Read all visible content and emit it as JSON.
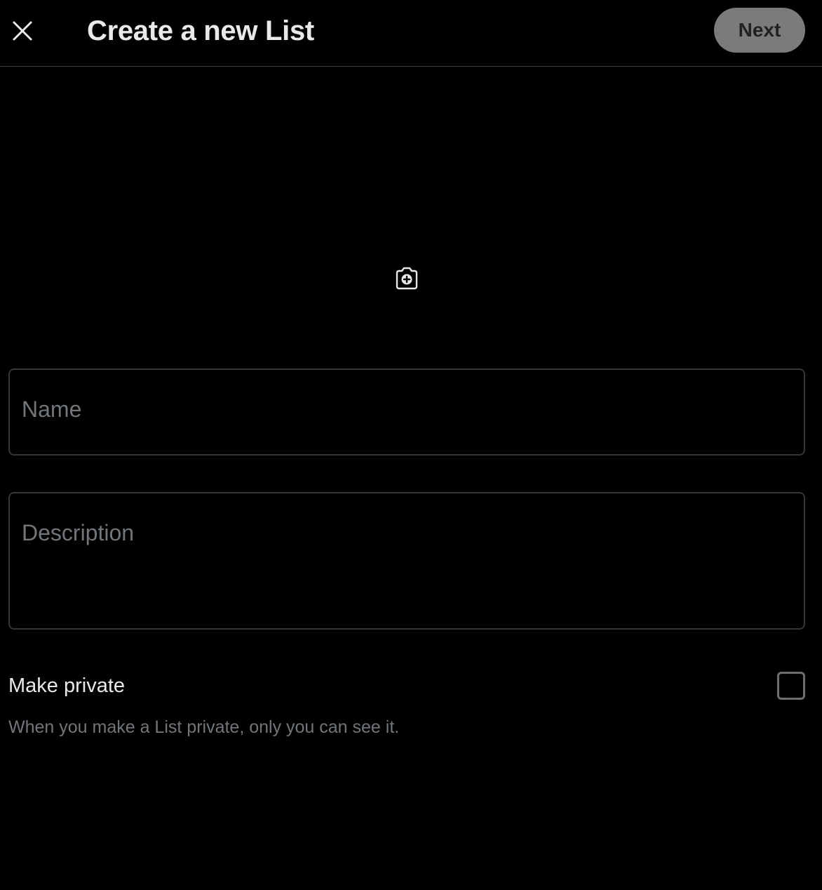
{
  "header": {
    "title": "Create a new List",
    "close_icon": "close-icon",
    "next_label": "Next"
  },
  "banner": {
    "camera_icon": "add-photo-camera-icon"
  },
  "form": {
    "name_placeholder": "Name",
    "name_value": "",
    "description_placeholder": "Description",
    "description_value": ""
  },
  "privacy": {
    "label": "Make private",
    "help_text": "When you make a List private, only you can see it.",
    "checked": false
  },
  "colors": {
    "background": "#000000",
    "next_button_bg": "#7a7b7d",
    "border": "#333639",
    "secondary_text": "#71767b"
  }
}
